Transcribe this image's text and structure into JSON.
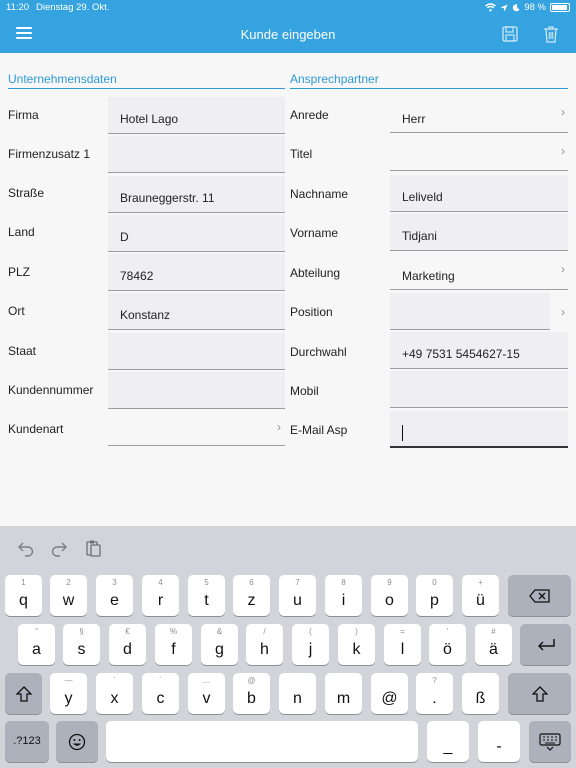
{
  "status_bar": {
    "time": "11:20",
    "date": "Dienstag 29. Okt.",
    "battery": "98 %"
  },
  "navbar": {
    "title": "Kunde eingeben",
    "icons": [
      "menu-icon",
      "save-icon",
      "trash-icon"
    ]
  },
  "company": {
    "title": "Unternehmensdaten",
    "fields": [
      {
        "label": "Firma",
        "value": "Hotel Lago"
      },
      {
        "label": "Firmenzusatz 1",
        "value": ""
      },
      {
        "label": "Straße",
        "value": "Brauneggerstr. 11"
      },
      {
        "label": "Land",
        "value": "D"
      },
      {
        "label": "PLZ",
        "value": "78462"
      },
      {
        "label": "Ort",
        "value": "Konstanz"
      },
      {
        "label": "Staat",
        "value": ""
      },
      {
        "label": "Kundennummer",
        "value": ""
      },
      {
        "label": "Kundenart",
        "value": ""
      }
    ]
  },
  "contact": {
    "title": "Ansprechpartner",
    "fields": [
      {
        "label": "Anrede",
        "value": "Herr"
      },
      {
        "label": "Titel",
        "value": ""
      },
      {
        "label": "Nachname",
        "value": "Leliveld"
      },
      {
        "label": "Vorname",
        "value": "Tidjani"
      },
      {
        "label": "Abteilung",
        "value": "Marketing"
      },
      {
        "label": "Position",
        "value": ""
      },
      {
        "label": "Durchwahl",
        "value": "+49 7531 5454627-15"
      },
      {
        "label": "Mobil",
        "value": ""
      },
      {
        "label": "E-Mail Asp",
        "value": ""
      }
    ]
  },
  "keyboard": {
    "row1": [
      {
        "h": "1",
        "c": "q"
      },
      {
        "h": "2",
        "c": "w"
      },
      {
        "h": "3",
        "c": "e"
      },
      {
        "h": "4",
        "c": "r"
      },
      {
        "h": "5",
        "c": "t"
      },
      {
        "h": "6",
        "c": "z"
      },
      {
        "h": "7",
        "c": "u"
      },
      {
        "h": "8",
        "c": "i"
      },
      {
        "h": "9",
        "c": "o"
      },
      {
        "h": "0",
        "c": "p"
      },
      {
        "h": "+",
        "c": "ü"
      }
    ],
    "row2": [
      {
        "h": "\"",
        "c": "a"
      },
      {
        "h": "§",
        "c": "s"
      },
      {
        "h": "€",
        "c": "d"
      },
      {
        "h": "%",
        "c": "f"
      },
      {
        "h": "&",
        "c": "g"
      },
      {
        "h": "/",
        "c": "h"
      },
      {
        "h": "(",
        "c": "j"
      },
      {
        "h": ")",
        "c": "k"
      },
      {
        "h": "=",
        "c": "l"
      },
      {
        "h": "'",
        "c": "ö"
      },
      {
        "h": "#",
        "c": "ä"
      }
    ],
    "row3": [
      {
        "h": "—",
        "c": "y"
      },
      {
        "h": "`",
        "c": "x"
      },
      {
        "h": "´",
        "c": "c"
      },
      {
        "h": "…",
        "c": "v"
      },
      {
        "h": "@",
        "c": "b"
      },
      {
        "h": "",
        "c": "n"
      },
      {
        "h": "",
        "c": "m"
      },
      {
        "h": "",
        "c": "@"
      },
      {
        "h": "?",
        "c": "."
      },
      {
        "h": "",
        "c": "ß"
      }
    ],
    "numbers_label": ".?123",
    "row4_right": [
      {
        "h": "",
        "c": "_"
      },
      {
        "h": "",
        "c": "-"
      }
    ]
  }
}
